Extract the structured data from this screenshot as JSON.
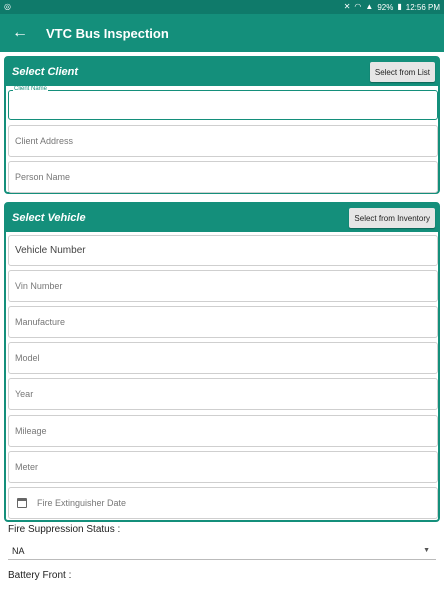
{
  "status_bar": {
    "app_icon": "android-circle-icon",
    "battery": "92%",
    "time": "12:56 PM"
  },
  "app_bar": {
    "title": "VTC Bus Inspection"
  },
  "client_section": {
    "title": "Select Client",
    "button_label": "Select from List",
    "client_name_label": "Client Name",
    "client_name_value": "",
    "client_address_placeholder": "Client Address",
    "person_name_placeholder": "Person Name"
  },
  "vehicle_section": {
    "title": "Select Vehicle",
    "button_label": "Select from Inventory",
    "vehicle_number_placeholder": "Vehicle Number",
    "vin_number_placeholder": "Vin Number",
    "manufacture_placeholder": "Manufacture",
    "model_placeholder": "Model",
    "year_placeholder": "Year",
    "mileage_placeholder": "Mileage",
    "meter_placeholder": "Meter",
    "fire_ext_date_placeholder": "Fire Extinguisher Date"
  },
  "fire_suppression": {
    "label": "Fire Suppression Status :",
    "selected": "NA"
  },
  "battery_front": {
    "label": "Battery Front :"
  },
  "colors": {
    "primary": "#148f7b",
    "status_bar": "#0f7a6a"
  }
}
